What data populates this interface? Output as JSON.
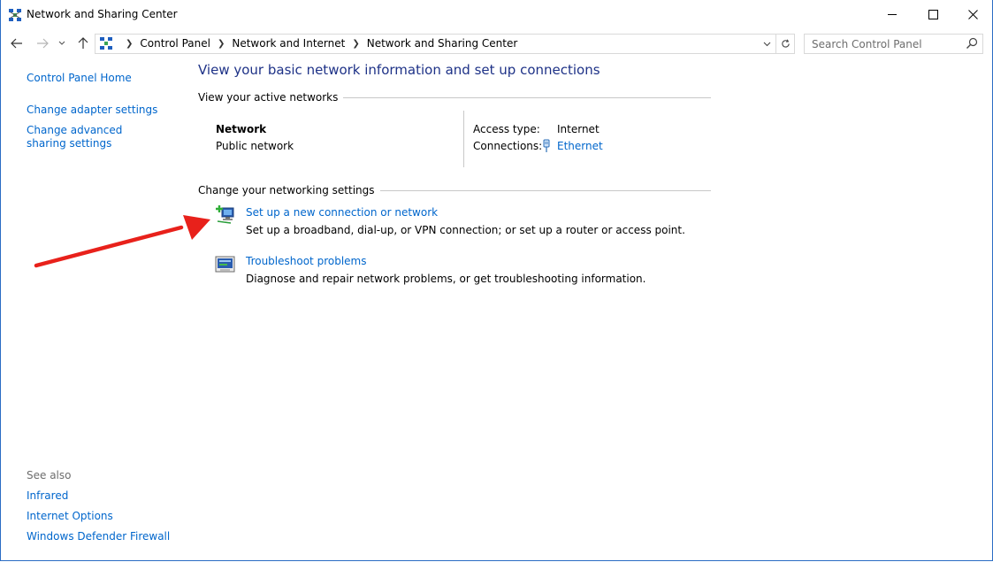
{
  "window": {
    "title": "Network and Sharing Center",
    "minimize": "minimize",
    "maximize": "maximize",
    "close": "close"
  },
  "address": {
    "breadcrumbs": [
      "Control Panel",
      "Network and Internet",
      "Network and Sharing Center"
    ]
  },
  "search": {
    "placeholder": "Search Control Panel"
  },
  "sidebar": {
    "home": "Control Panel Home",
    "links": [
      "Change adapter settings",
      "Change advanced sharing settings"
    ],
    "see_also_title": "See also",
    "see_also": [
      "Infrared",
      "Internet Options",
      "Windows Defender Firewall"
    ]
  },
  "main": {
    "heading": "View your basic network information and set up connections",
    "active_title": "View your active networks",
    "network": {
      "name": "Network",
      "type": "Public network",
      "access_label": "Access type:",
      "access_value": "Internet",
      "connections_label": "Connections:",
      "connections_value": "Ethernet"
    },
    "settings_title": "Change your networking settings",
    "tasks": [
      {
        "link": "Set up a new connection or network",
        "desc": "Set up a broadband, dial-up, or VPN connection; or set up a router or access point."
      },
      {
        "link": "Troubleshoot problems",
        "desc": "Diagnose and repair network problems, or get troubleshooting information."
      }
    ]
  },
  "annotation": {
    "arrow_color": "#e8211b"
  },
  "colors": {
    "link": "#0066cc",
    "heading": "#1e3287",
    "border": "#2b6cc4"
  }
}
